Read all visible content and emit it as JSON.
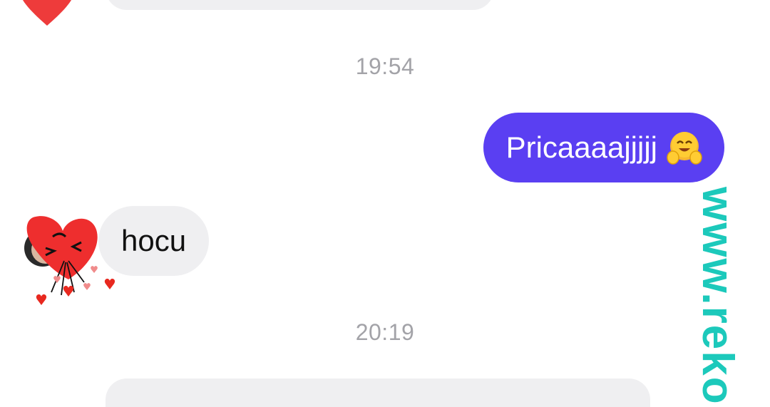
{
  "chat": {
    "timestamps": [
      "19:54",
      "20:19"
    ],
    "outgoing_message": {
      "text": "Pricaaaajjjjj",
      "emoji": "hugging-face-icon",
      "bubble_color": "#5a3ff2"
    },
    "incoming_message": {
      "text": "hocu",
      "bubble_color": "#efeff1"
    },
    "avatar_sticker": "heart-sticker-icon"
  },
  "watermark": {
    "text": "www.reko",
    "color": "#1cc9bb"
  }
}
